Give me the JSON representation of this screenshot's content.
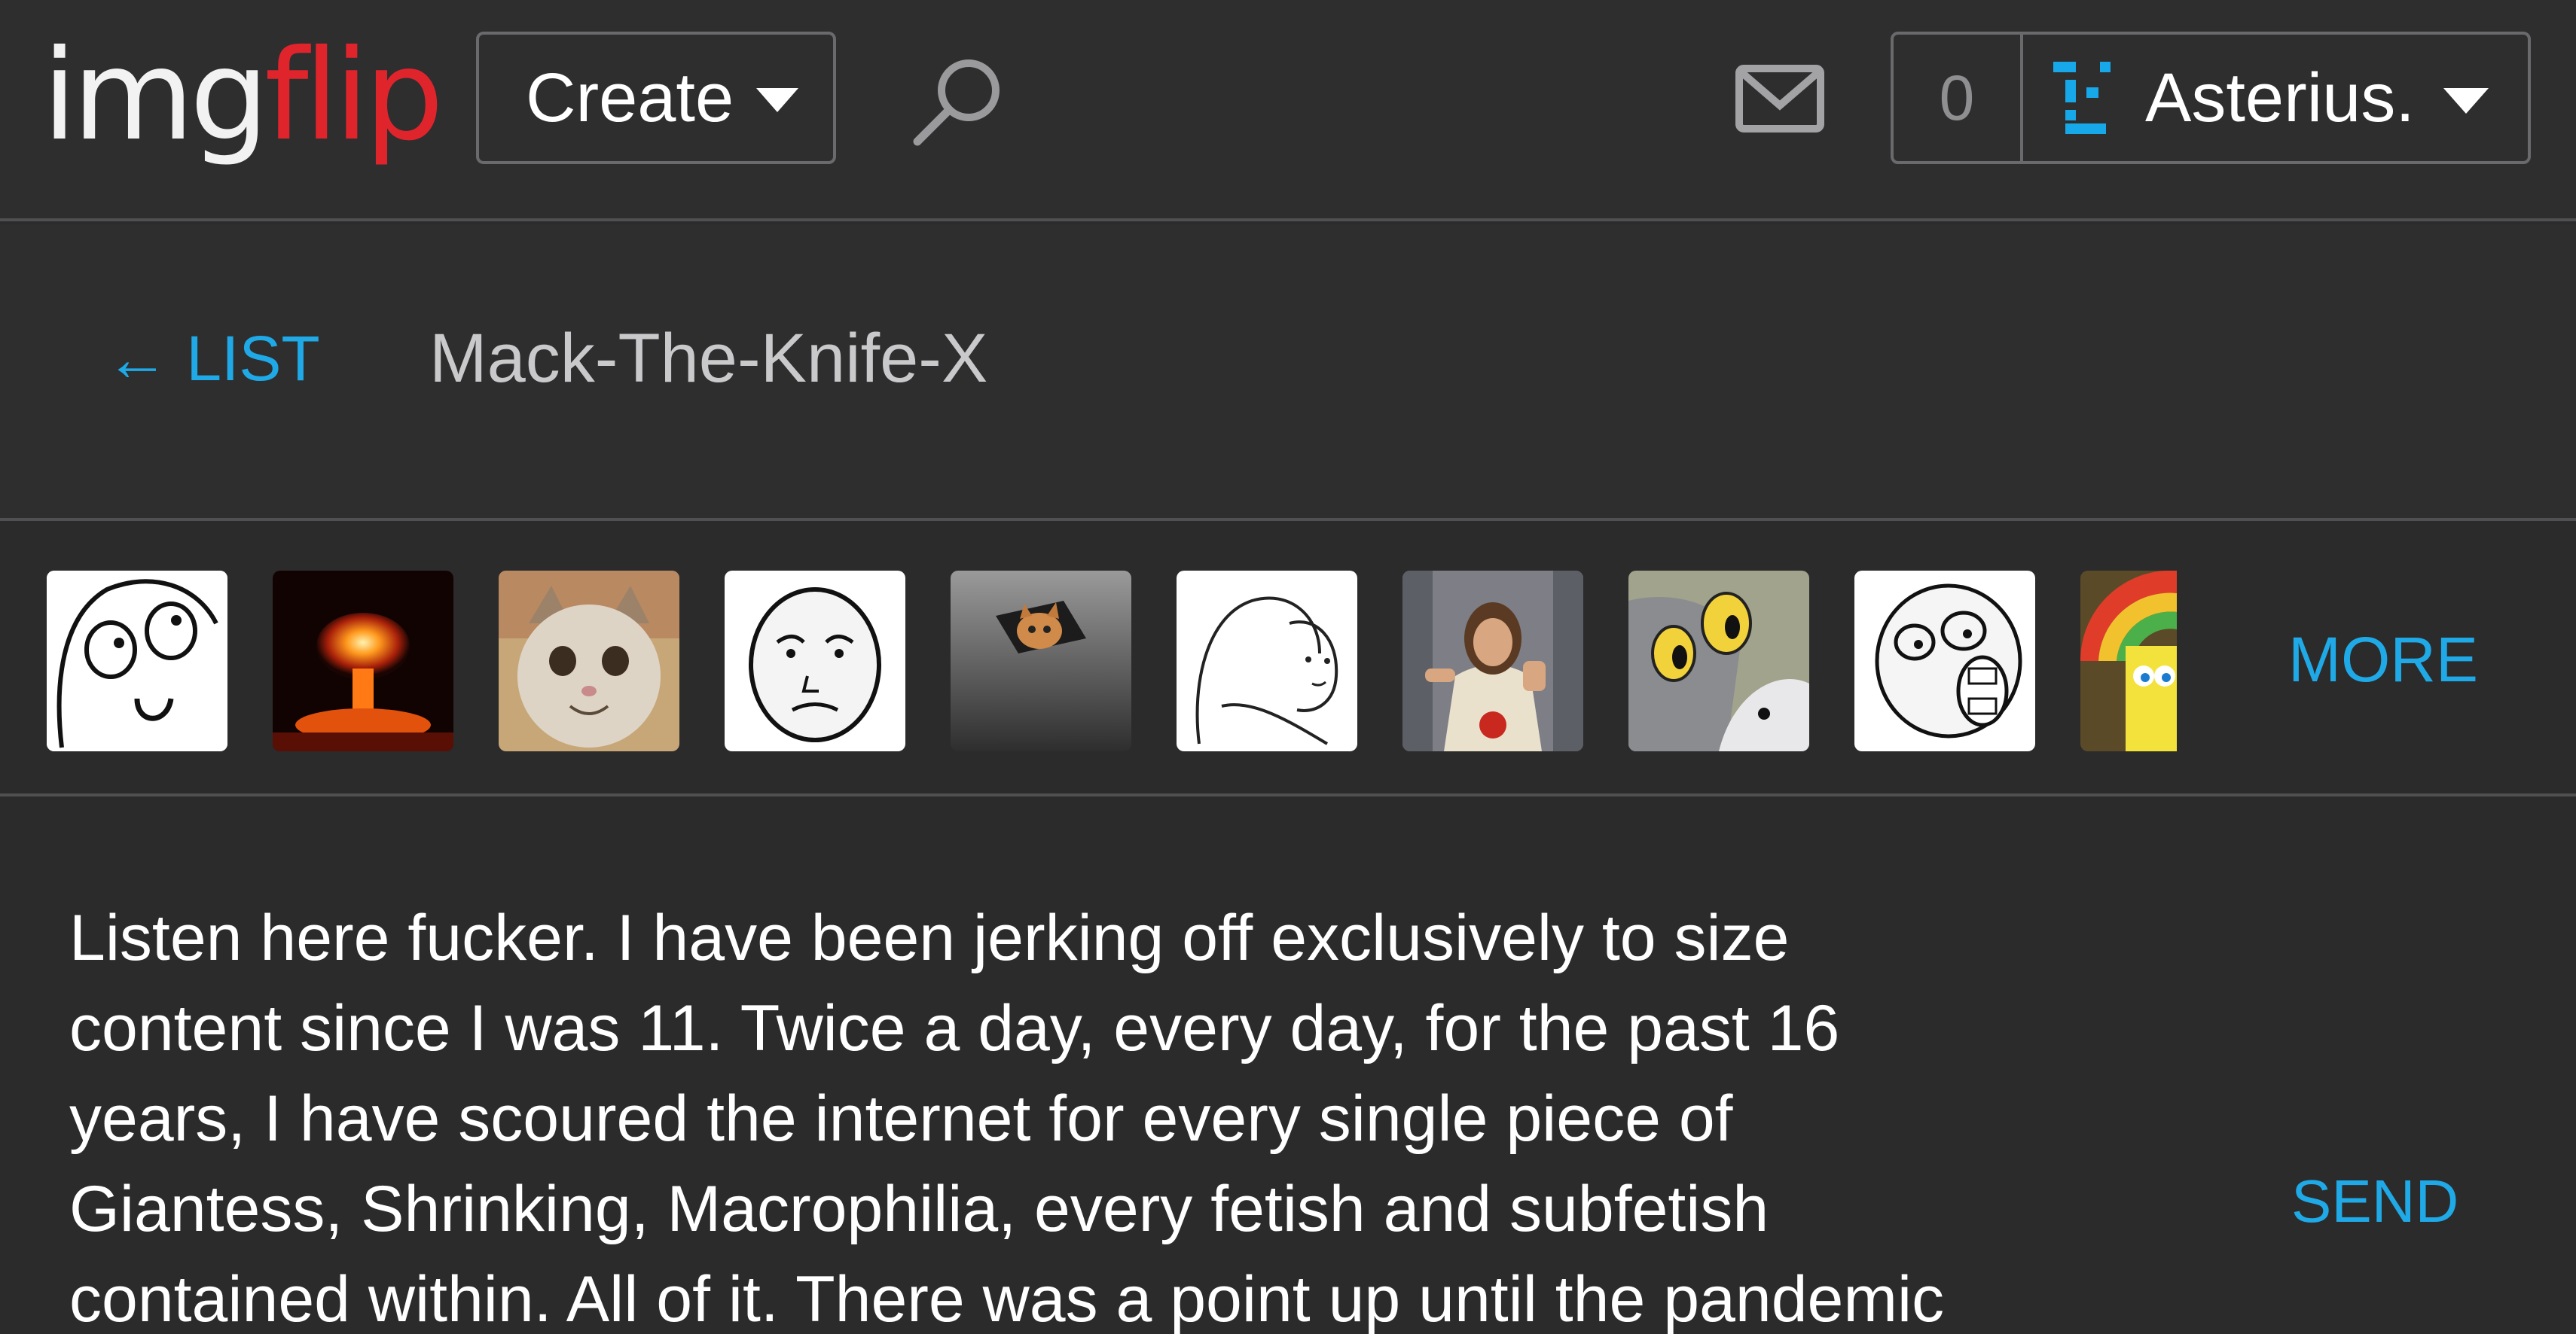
{
  "header": {
    "logo_left": "img",
    "logo_right": "flip",
    "create_label": "Create",
    "notification_count": "0",
    "username": "Asterius."
  },
  "chat": {
    "back_label": "← LIST",
    "partner_name": "Mack-The-Knife-X"
  },
  "thumbnails": {
    "items": [
      "derp-face",
      "nuclear-explosion",
      "smiling-cat",
      "okay-face",
      "ceiling-cat",
      "wojak-hug",
      "buddy-christ",
      "unsettled-tom",
      "lol-face",
      "imagination-spongebob"
    ],
    "more_label": "MORE"
  },
  "compose": {
    "message": "Listen here fucker. I have been jerking off exclusively to size\ncontent since I was 11. Twice a day, every day, for the past 16\nyears, I have scoured the internet for every single piece of\nGiantess, Shrinking, Macrophilia, every fetish and subfetish\ncontained within. All of it. There was a point up until the pandemic",
    "send_label": "SEND"
  },
  "colors": {
    "accent": "#1fa9e6",
    "logo_red": "#e0242c",
    "background": "#2b2b2b"
  }
}
